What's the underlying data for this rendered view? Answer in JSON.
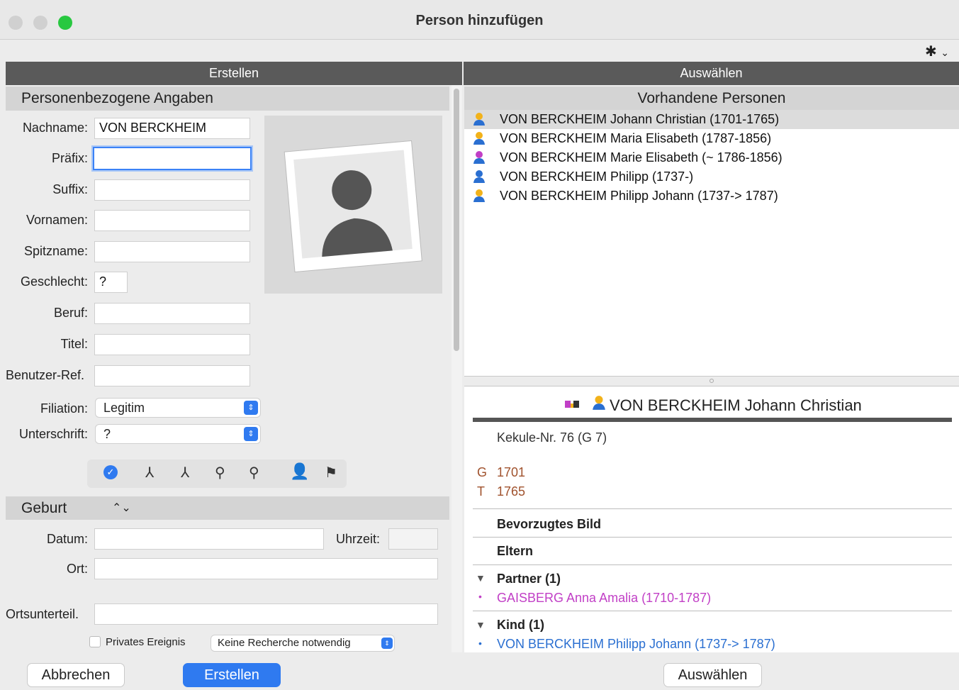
{
  "window": {
    "title": "Person hinzufügen"
  },
  "colors": {
    "close": "#ff5f57",
    "minimize": "#febc2e",
    "zoom": "#28c840",
    "accent": "#2f7af0",
    "male": "#2a6fd1",
    "female": "#c13fc6",
    "unknown_gender": "#f2b21a"
  },
  "toolbar": {
    "settings_icon": "gear-icon",
    "settings_chevron": "⌄"
  },
  "left": {
    "header": "Erstellen",
    "section_personal": "Personenbezogene Angaben",
    "labels": {
      "nachname": "Nachname:",
      "praefix": "Präfix:",
      "suffix": "Suffix:",
      "vornamen": "Vornamen:",
      "spitzname": "Spitzname:",
      "geschlecht": "Geschlecht:",
      "beruf": "Beruf:",
      "titel": "Titel:",
      "benutzer_ref": "Benutzer-Ref.",
      "filiation": "Filiation:",
      "unterschrift": "Unterschrift:"
    },
    "values": {
      "nachname": "VON BERCKHEIM",
      "praefix": "",
      "suffix": "",
      "vornamen": "",
      "spitzname": "",
      "geschlecht": "?",
      "beruf": "",
      "titel": "",
      "benutzer_ref": "",
      "filiation": "Legitim",
      "unterschrift": "?"
    },
    "event_section": {
      "label": "Geburt",
      "datum_label": "Datum:",
      "uhrzeit_label": "Uhrzeit:",
      "ort_label": "Ort:",
      "ortsunterteil_label": "Ortsunterteil.",
      "datum": "",
      "uhrzeit": "",
      "ort": "",
      "ortsunterteil": "",
      "private_label": "Privates Ereignis",
      "research_value": "Keine Recherche notwendig"
    }
  },
  "right": {
    "header": "Auswählen",
    "list_title": "Vorhandene Personen",
    "persons": [
      {
        "name": "VON BERCKHEIM Johann Christian (1701-1765)",
        "gender": "unknown"
      },
      {
        "name": "VON BERCKHEIM Maria Elisabeth (1787-1856)",
        "gender": "unknown"
      },
      {
        "name": "VON BERCKHEIM Marie Elisabeth (~ 1786-1856)",
        "gender": "female"
      },
      {
        "name": "VON BERCKHEIM Philipp (1737-)",
        "gender": "male"
      },
      {
        "name": "VON BERCKHEIM Philipp Johann (1737-> 1787)",
        "gender": "unknown"
      }
    ],
    "detail": {
      "name": "VON BERCKHEIM Johann Christian",
      "kekule": "Kekule-Nr. 76 (G 7)",
      "birth_label": "G",
      "birth_year": "1701",
      "death_label": "T",
      "death_year": "1765",
      "pref_image": "Bevorzugtes Bild",
      "parents": "Eltern",
      "partner_header": "Partner (1)",
      "partner_name": "GAISBERG Anna Amalia (1710-1787)",
      "child_header": "Kind (1)",
      "child_name": "VON BERCKHEIM Philipp Johann (1737-> 1787)"
    }
  },
  "buttons": {
    "cancel": "Abbrechen",
    "create": "Erstellen",
    "select": "Auswählen"
  }
}
